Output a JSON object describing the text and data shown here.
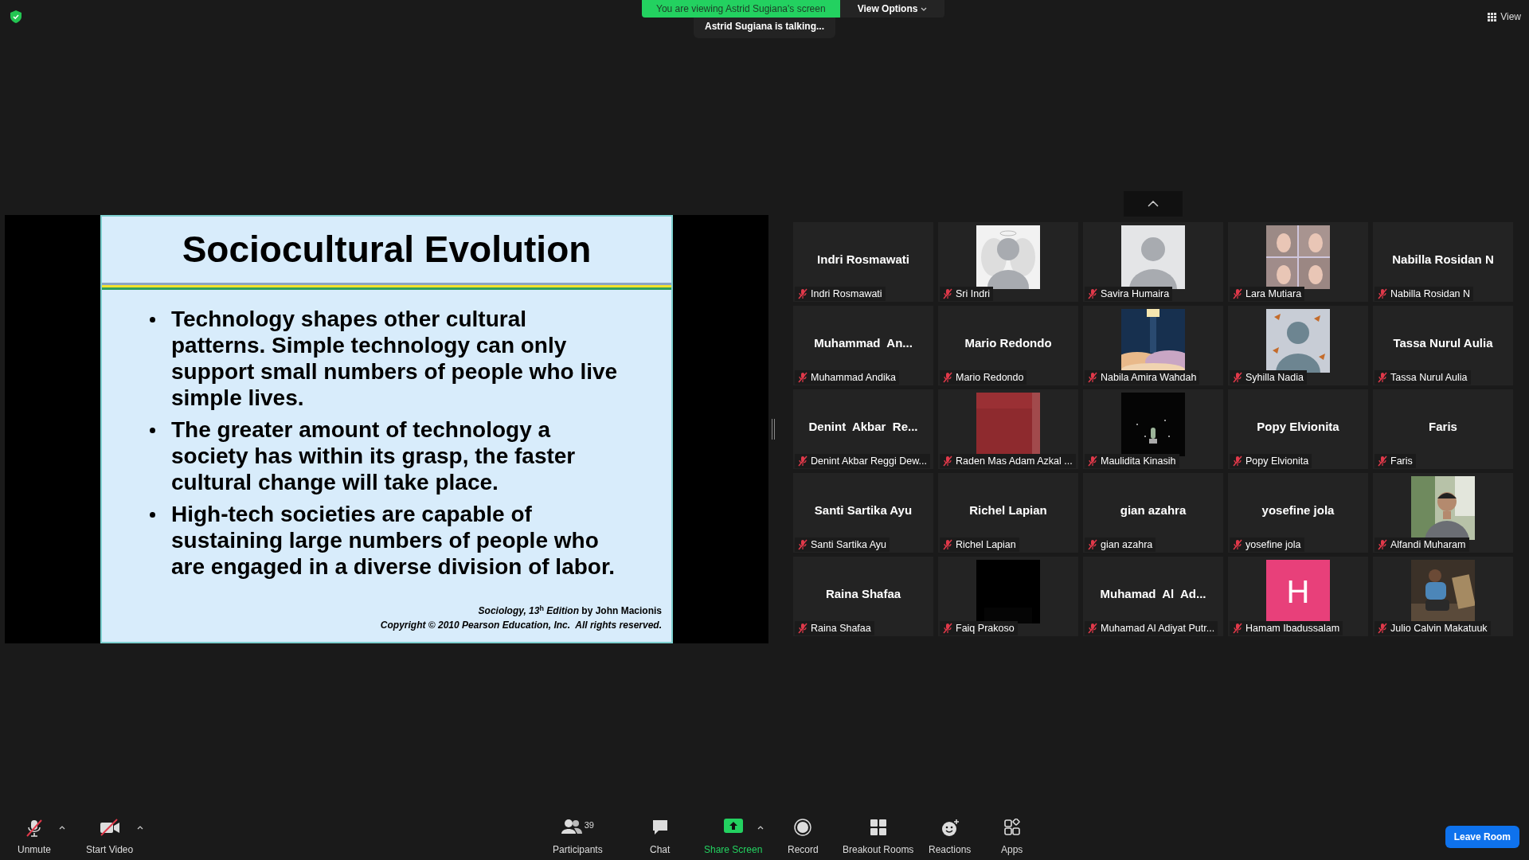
{
  "top_bar": {
    "banner": "You are viewing Astrid Sugiana's screen",
    "view_options": "View Options",
    "talking": "Astrid Sugiana is talking...",
    "view": "View"
  },
  "slide": {
    "title": "Sociocultural Evolution",
    "bullets": [
      "Technology shapes other cultural patterns. Simple technology can only support small numbers of people who live simple lives.",
      "The greater amount of technology a society has within its grasp, the faster cultural change will take place.",
      "High-tech societies are capable of sustaining large numbers of people who are engaged in a diverse division of labor."
    ],
    "credit": "*Sociology, 13*$^{h}$ *Edition* by John Macionis",
    "copyright": "Copyright © 2010 Pearson Education, Inc.  All rights reserved."
  },
  "participants": [
    {
      "kind": "name",
      "display": "Indri Rosmawati",
      "label": "Indri Rosmawati",
      "muted": true
    },
    {
      "kind": "picture",
      "label": "Sri Indri",
      "muted": true
    },
    {
      "kind": "picture",
      "label": "Savira Humaira",
      "muted": true
    },
    {
      "kind": "picture",
      "label": "Lara Mutiara",
      "muted": true
    },
    {
      "kind": "name",
      "display": "Nabilla Rosidan N",
      "label": "Nabilla Rosidan N",
      "muted": true
    },
    {
      "kind": "name",
      "display": "Muhammad  An...",
      "label": "Muhammad Andika",
      "muted": true
    },
    {
      "kind": "name",
      "display": "Mario Redondo",
      "label": "Mario Redondo",
      "muted": true
    },
    {
      "kind": "picture",
      "label": "Nabila Amira Wahdah",
      "muted": true
    },
    {
      "kind": "picture",
      "label": "Syhilla Nadia",
      "muted": true
    },
    {
      "kind": "name",
      "display": "Tassa Nurul Aulia",
      "label": "Tassa Nurul Aulia",
      "muted": true
    },
    {
      "kind": "name",
      "display": "Denint  Akbar  Re...",
      "label": "Denint Akbar Reggi Dew...",
      "muted": true
    },
    {
      "kind": "picture",
      "label": "Raden Mas Adam Azkal ...",
      "muted": true
    },
    {
      "kind": "picture",
      "label": "Maulidita Kinasih",
      "muted": true
    },
    {
      "kind": "name",
      "display": "Popy Elvionita",
      "label": "Popy Elvionita",
      "muted": true
    },
    {
      "kind": "name",
      "display": "Faris",
      "label": "Faris",
      "muted": true
    },
    {
      "kind": "name",
      "display": "Santi Sartika Ayu",
      "label": "Santi Sartika Ayu",
      "muted": true
    },
    {
      "kind": "name",
      "display": "Richel Lapian",
      "label": "Richel Lapian",
      "muted": true
    },
    {
      "kind": "name",
      "display": "gian azahra",
      "label": "gian azahra",
      "muted": true
    },
    {
      "kind": "name",
      "display": "yosefine jola",
      "label": "yosefine jola",
      "muted": true
    },
    {
      "kind": "picture",
      "label": "Alfandi Muharam",
      "muted": true
    },
    {
      "kind": "name",
      "display": "Raina Shafaa",
      "label": "Raina Shafaa",
      "muted": true
    },
    {
      "kind": "picture",
      "label": "Faiq Prakoso",
      "muted": true
    },
    {
      "kind": "name",
      "display": "Muhamad  Al  Ad...",
      "label": "Muhamad Al Adiyat Putr...",
      "muted": true
    },
    {
      "kind": "letter",
      "letter": "H",
      "color": "#e8407a",
      "label": "Hamam Ibadussalam",
      "muted": true
    },
    {
      "kind": "picture",
      "label": "Julio Calvin Makatuuk",
      "muted": true
    }
  ],
  "toolbar": [
    {
      "kind": "mic",
      "label": "Unmute",
      "caret": true
    },
    {
      "kind": "video",
      "label": "Start Video",
      "caret": true
    },
    {
      "kind": "participants",
      "label": "Participants",
      "count": "39",
      "caret": false
    },
    {
      "kind": "chat",
      "label": "Chat",
      "caret": false
    },
    {
      "kind": "share",
      "label": "Share Screen",
      "caret": true
    },
    {
      "kind": "record",
      "label": "Record",
      "caret": false
    },
    {
      "kind": "breakout",
      "label": "Breakout Rooms",
      "caret": false
    },
    {
      "kind": "reactions",
      "label": "Reactions",
      "caret": false
    },
    {
      "kind": "apps",
      "label": "Apps",
      "caret": false
    }
  ],
  "leave": "Leave Room"
}
